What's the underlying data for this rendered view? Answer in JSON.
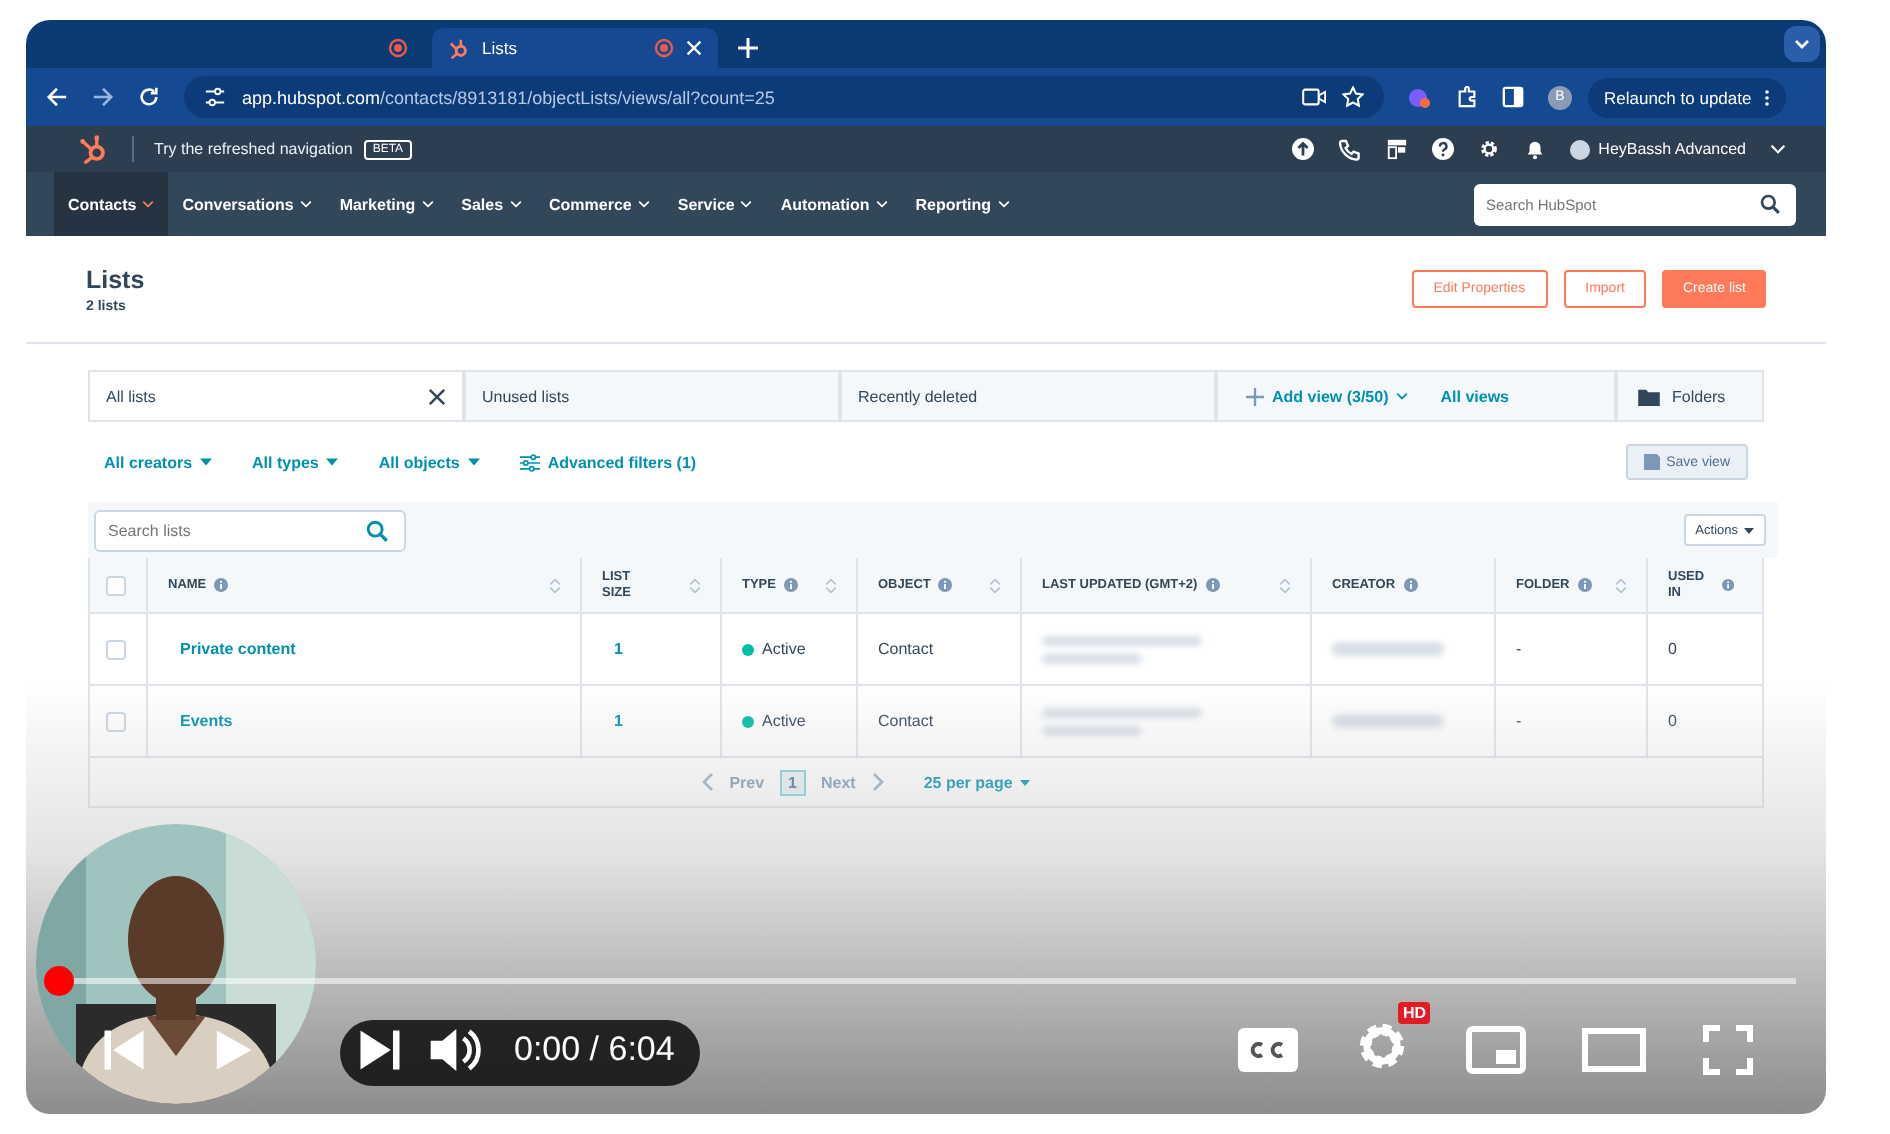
{
  "browser": {
    "tabs": [
      {
        "selected": false
      },
      {
        "title": "Lists",
        "selected": true
      }
    ],
    "address": {
      "host": "app.hubspot.com",
      "path": "/contacts/8913181/objectLists/views/all?count=25"
    },
    "profile": "B",
    "relaunch": "Relaunch to update"
  },
  "topbar": {
    "promo": "Try the refreshed navigation",
    "badge": "BETA",
    "account": "HeyBassh Advanced"
  },
  "nav": {
    "items": [
      {
        "label": "Contacts",
        "selected": true
      },
      {
        "label": "Conversations",
        "selected": false
      },
      {
        "label": "Marketing",
        "selected": false
      },
      {
        "label": "Sales",
        "selected": false
      },
      {
        "label": "Commerce",
        "selected": false
      },
      {
        "label": "Service",
        "selected": false
      },
      {
        "label": "Automation",
        "selected": false
      },
      {
        "label": "Reporting",
        "selected": false
      }
    ],
    "search": {
      "placeholder": "Search HubSpot"
    }
  },
  "header": {
    "title": "Lists",
    "subtitle": "2 lists",
    "buttons": [
      {
        "label": "Edit Properties",
        "kind": "outline"
      },
      {
        "label": "Import",
        "kind": "outline"
      },
      {
        "label": "Create list",
        "kind": "primary"
      }
    ]
  },
  "view_tabs": [
    {
      "label": "All lists",
      "selected": true
    },
    {
      "label": "Unused lists",
      "selected": false
    },
    {
      "label": "Recently deleted",
      "selected": false
    }
  ],
  "add_view": "Add view (3/50)",
  "all_views": "All views",
  "folders": "Folders",
  "filters": [
    "All creators",
    "All types",
    "All objects"
  ],
  "advanced_filters": "Advanced filters (1)",
  "save_view": "Save view",
  "search_lists": {
    "placeholder": "Search lists"
  },
  "actions": "Actions",
  "table": {
    "select_all": false,
    "columns": [
      {
        "label": "NAME",
        "info": true,
        "sortable": true
      },
      {
        "label": "LIST SIZE",
        "info": false,
        "sortable": true
      },
      {
        "label": "TYPE",
        "info": true,
        "sortable": true
      },
      {
        "label": "OBJECT",
        "info": true,
        "sortable": true
      },
      {
        "label": "LAST UPDATED (GMT+2)",
        "info": true,
        "sortable": true
      },
      {
        "label": "CREATOR",
        "info": true,
        "sortable": false
      },
      {
        "label": "FOLDER",
        "info": true,
        "sortable": true
      },
      {
        "label": "USED IN",
        "info": true,
        "sortable": false
      }
    ],
    "rows": [
      {
        "checked": false,
        "name": "Private content",
        "size": "1",
        "type": "Active",
        "object": "Contact",
        "folder": "-",
        "used_in": "0"
      },
      {
        "checked": false,
        "name": "Events",
        "size": "1",
        "type": "Active",
        "object": "Contact",
        "folder": "-",
        "used_in": "0"
      }
    ]
  },
  "pagination": {
    "prev": "Prev",
    "page": "1",
    "next": "Next",
    "per_page": "25 per page"
  },
  "player": {
    "level": 0.0,
    "time": "0:00 / 6:04",
    "hd": "HD"
  }
}
